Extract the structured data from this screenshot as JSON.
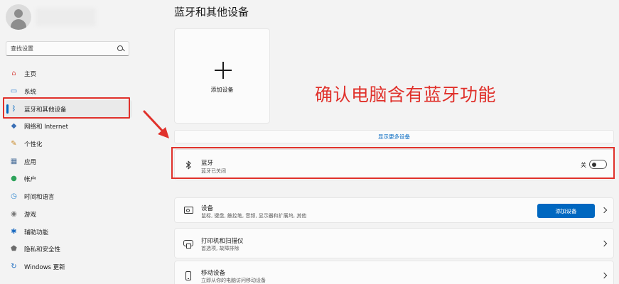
{
  "sidebar": {
    "search_placeholder": "查找设置",
    "items": [
      {
        "label": "主页",
        "icon": "home-icon",
        "glyph": "⌂",
        "color": "#d9534f"
      },
      {
        "label": "系统",
        "icon": "system-icon",
        "glyph": "▭",
        "color": "#2f7fd0"
      },
      {
        "label": "蓝牙和其他设备",
        "icon": "bluetooth-icon",
        "glyph": "ᛒ",
        "color": "#0067c0"
      },
      {
        "label": "网络和 Internet",
        "icon": "network-icon",
        "glyph": "◆",
        "color": "#3a6fb5"
      },
      {
        "label": "个性化",
        "icon": "brush-icon",
        "glyph": "✎",
        "color": "#c98a2b"
      },
      {
        "label": "应用",
        "icon": "apps-icon",
        "glyph": "▦",
        "color": "#4a6f9a"
      },
      {
        "label": "帐户",
        "icon": "account-icon",
        "glyph": "●",
        "color": "#2fa35b"
      },
      {
        "label": "时间和语言",
        "icon": "clock-globe-icon",
        "glyph": "◷",
        "color": "#2f86d0"
      },
      {
        "label": "游戏",
        "icon": "gamepad-icon",
        "glyph": "◉",
        "color": "#7a7a7a"
      },
      {
        "label": "辅助功能",
        "icon": "accessibility-icon",
        "glyph": "✱",
        "color": "#1a6ac0"
      },
      {
        "label": "隐私和安全性",
        "icon": "shield-icon",
        "glyph": "⬟",
        "color": "#6b6b6b"
      },
      {
        "label": "Windows 更新",
        "icon": "update-icon",
        "glyph": "↻",
        "color": "#1a6ac0"
      }
    ],
    "active_index": 2
  },
  "main": {
    "title": "蓝牙和其他设备",
    "add_device_label": "添加设备",
    "show_more": "显示更多设备",
    "annotation": "确认电脑含有蓝牙功能",
    "bluetooth": {
      "title": "蓝牙",
      "subtitle": "蓝牙已关闭",
      "toggle_label": "关"
    },
    "devices": {
      "title": "设备",
      "subtitle": "鼠标, 键盘, 触控笔, 音频, 显示器和扩展坞, 其他",
      "button": "添加设备"
    },
    "printers": {
      "title": "打印机和扫描仪",
      "subtitle": "首选项, 故障排除"
    },
    "mobile": {
      "title": "移动设备",
      "subtitle": "立即从你的电脑访问移动设备"
    }
  },
  "colors": {
    "accent": "#0067c0",
    "highlight": "#e0312b",
    "background": "#f3f3f3"
  }
}
